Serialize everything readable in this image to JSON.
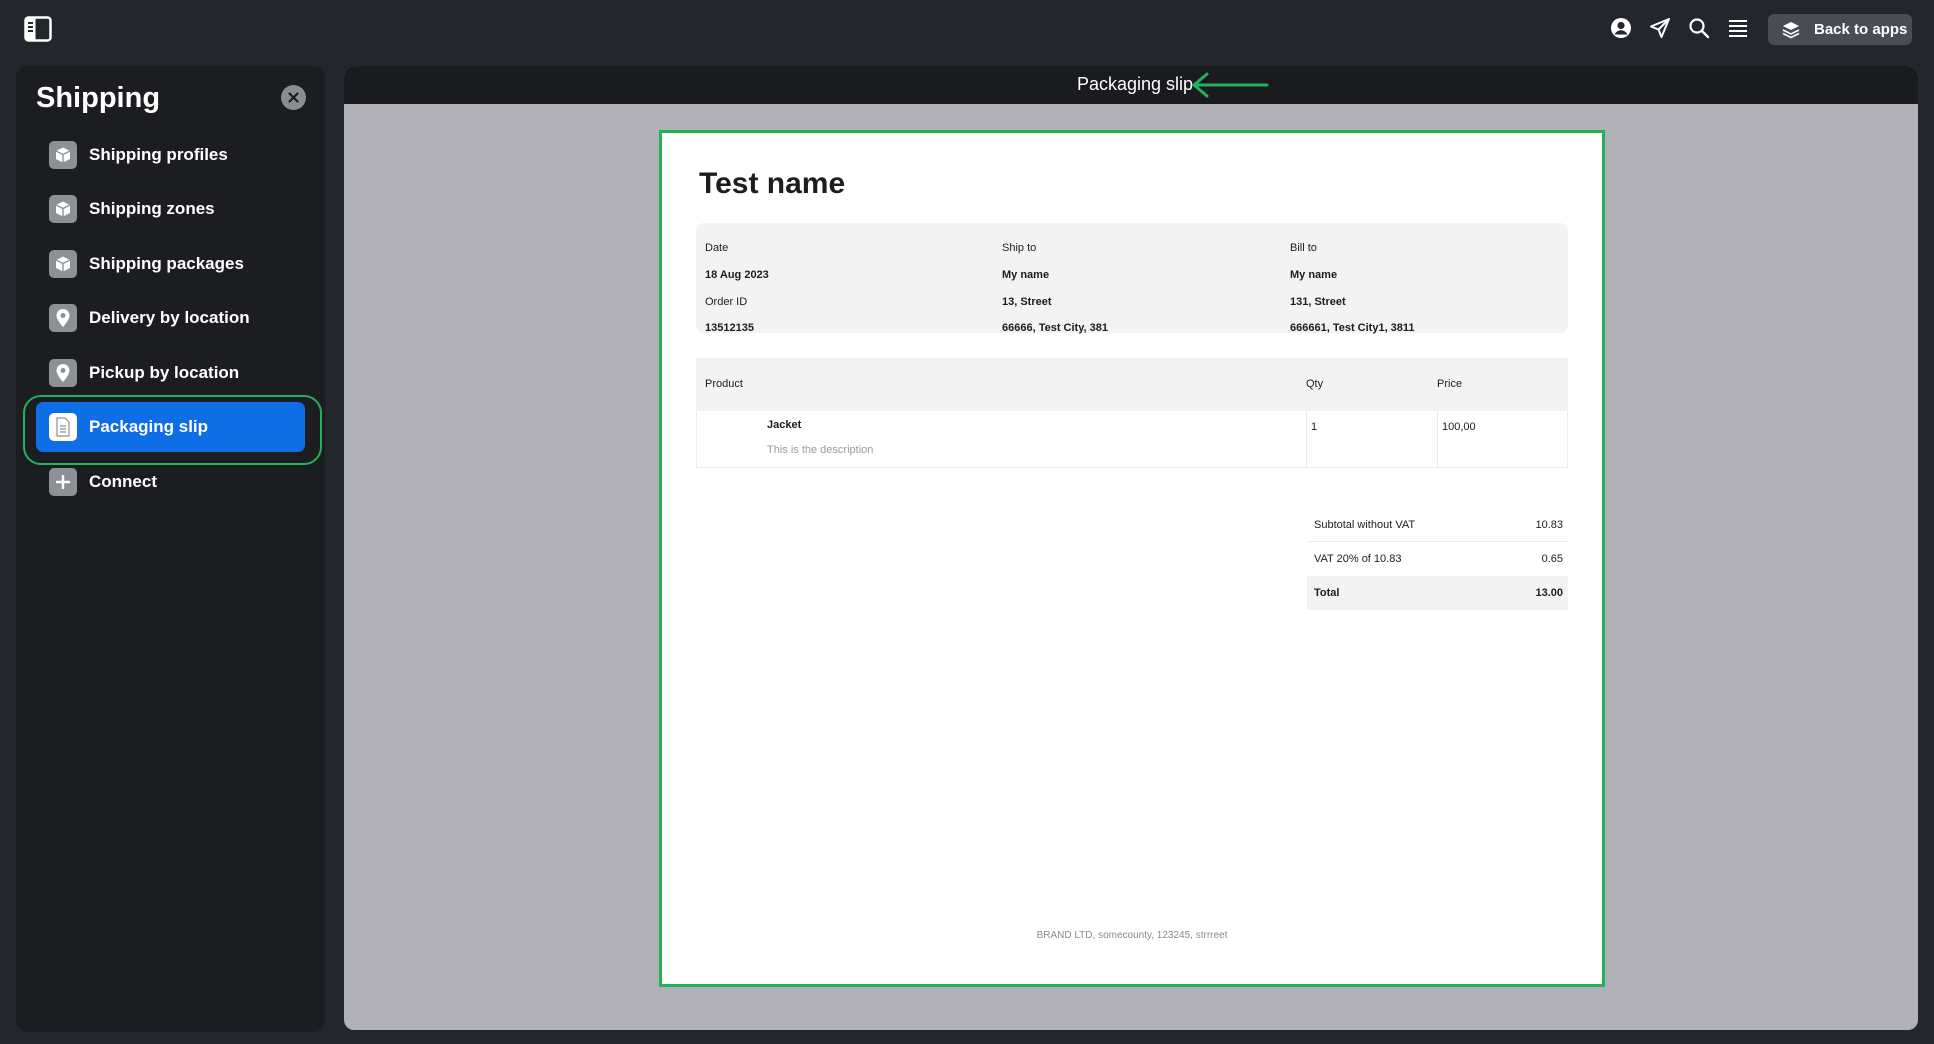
{
  "topbar": {
    "icons": [
      "panel-toggle-icon",
      "user-icon",
      "send-icon",
      "search-icon",
      "menu-icon"
    ],
    "back_to_apps": "Back to apps"
  },
  "sidebar": {
    "title": "Shipping",
    "items": [
      {
        "label": "Shipping profiles",
        "icon": "box-icon",
        "active": false
      },
      {
        "label": "Shipping zones",
        "icon": "box-icon",
        "active": false
      },
      {
        "label": "Shipping packages",
        "icon": "box-icon",
        "active": false
      },
      {
        "label": "Delivery by location",
        "icon": "location-pin-icon",
        "active": false
      },
      {
        "label": "Pickup by location",
        "icon": "location-pin-icon",
        "active": false
      },
      {
        "label": "Packaging slip",
        "icon": "document-icon",
        "active": true
      },
      {
        "label": "Connect",
        "icon": "plus-icon",
        "active": false
      }
    ]
  },
  "preview": {
    "title": "Packaging slip",
    "slip": {
      "name": "Test name",
      "date_label": "Date",
      "date": "18 Aug 2023",
      "order_id_label": "Order ID",
      "order_id": "13512135",
      "ship_to_label": "Ship to",
      "ship_to": {
        "name": "My name",
        "street": "13, Street",
        "city": "66666, Test City, 381"
      },
      "bill_to_label": "Bill to",
      "bill_to": {
        "name": "My name",
        "street": "131, Street",
        "city": "666661, Test City1, 3811"
      },
      "columns": {
        "product": "Product",
        "qty": "Qty",
        "price": "Price"
      },
      "items": [
        {
          "name": "Jacket",
          "description": "This is the description",
          "qty": "1",
          "price": "100,00"
        }
      ],
      "totals": {
        "subtotal_label": "Subtotal without VAT",
        "subtotal": "10.83",
        "vat_label": "VAT 20% of 10.83",
        "vat": "0.65",
        "total_label": "Total",
        "total": "13.00"
      },
      "footer": "BRAND LTD, somecounty, 123245, strrreet"
    }
  },
  "colors": {
    "accent": "#0d6ee6",
    "highlight": "#1fb35a",
    "background": "#23262d",
    "sidebar": "#1c1d20"
  }
}
